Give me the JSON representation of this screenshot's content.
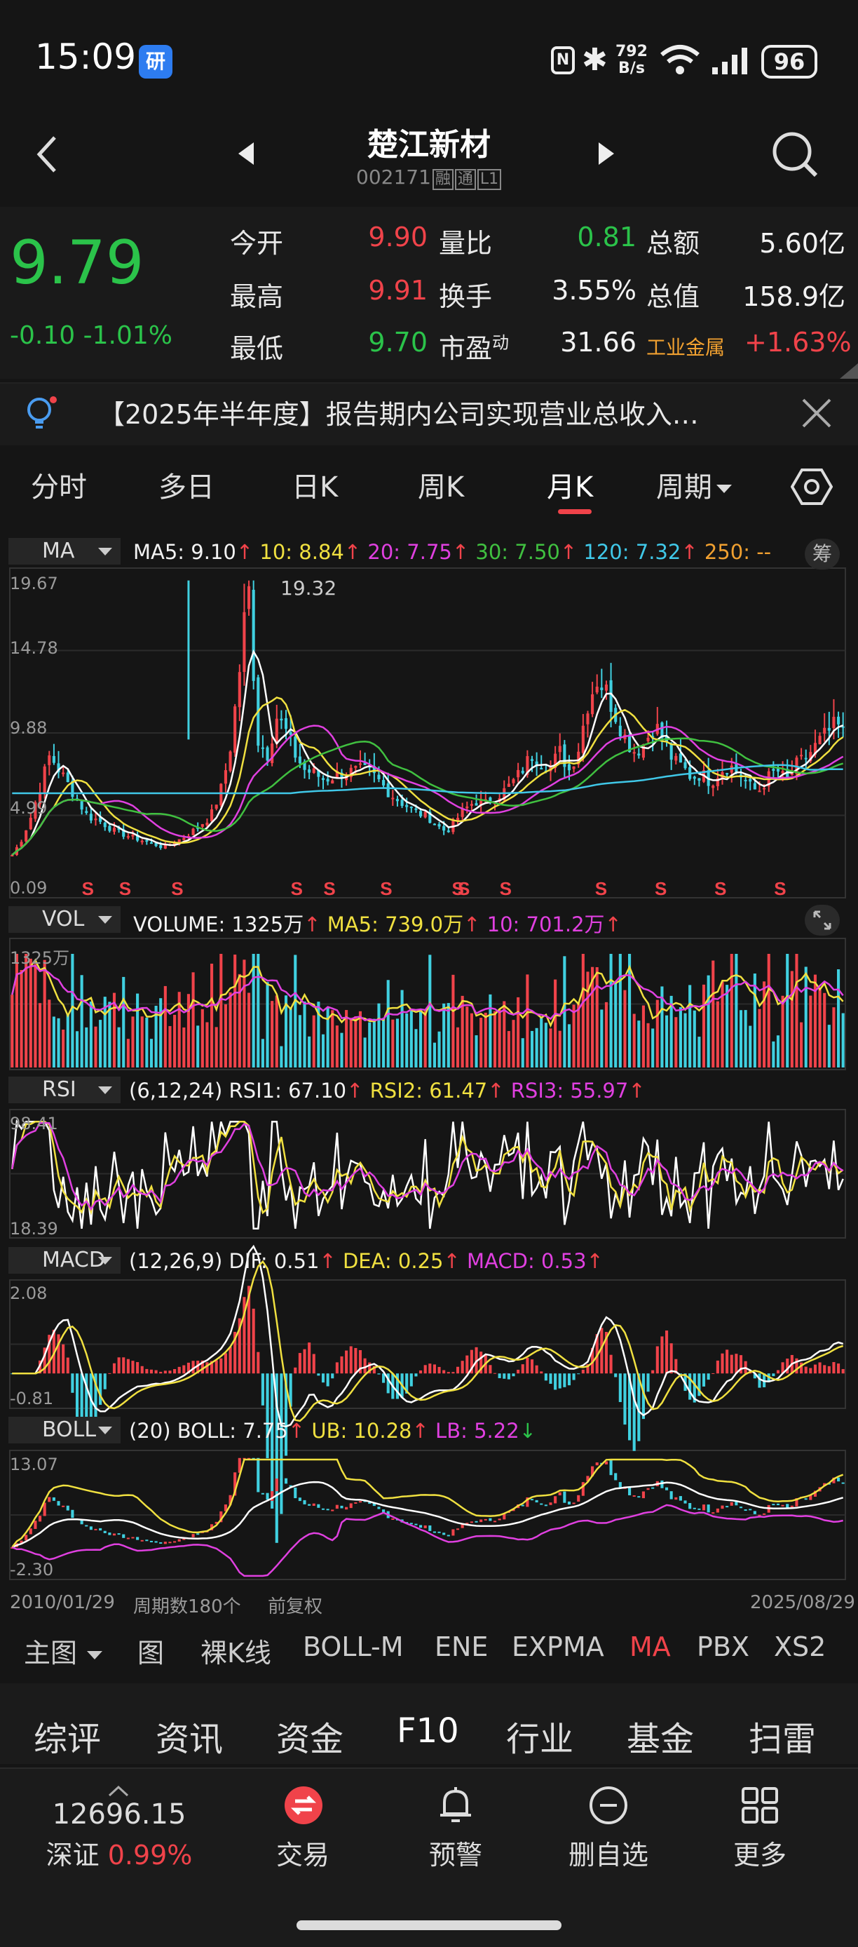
{
  "status": {
    "time": "15:09",
    "app_badge": "研",
    "nfc": "N",
    "bt": "✱",
    "net_value": "792",
    "net_unit": "B/s",
    "battery": "96"
  },
  "header": {
    "name": "楚江新材",
    "code": "002171",
    "tags": [
      "融",
      "通",
      "L1"
    ]
  },
  "quote": {
    "price": "9.79",
    "change": "-0.10",
    "change_pct": "-1.01%",
    "rows": [
      {
        "l1": "今开",
        "v1": "9.90",
        "l2": "量比",
        "v2": "0.81",
        "l3": "总额",
        "v3": "5.60亿"
      },
      {
        "l1": "最高",
        "v1": "9.91",
        "l2": "换手",
        "v2": "3.55%",
        "l3": "总值",
        "v3": "158.9亿"
      },
      {
        "l1": "最低",
        "v1": "9.70",
        "l2": "市盈",
        "l2sup": "动",
        "v2": "31.66"
      }
    ],
    "industry": "工业金属",
    "industry_change": "+1.63%"
  },
  "news": "【2025年半年度】报告期内公司实现营业总收入…",
  "tabs": [
    "分时",
    "多日",
    "日K",
    "周K",
    "月K",
    "周期"
  ],
  "indicators": {
    "ma": {
      "btn": "MA",
      "ma5": "MA5: 9.10",
      "ma10": "10: 8.84",
      "ma20": "20: 7.75",
      "ma30": "30: 7.50",
      "ma120": "120: 7.32",
      "ma250": "250: --",
      "chip": "筹",
      "yticks": [
        "19.67",
        "14.78",
        "9.88",
        "4.99",
        "0.09"
      ],
      "peak": "19.32",
      "signals": [
        "S",
        "S",
        "S",
        "S",
        "S",
        "S",
        "S",
        "S",
        "S",
        "S",
        "S",
        "S",
        "S"
      ]
    },
    "vol": {
      "btn": "VOL",
      "volume": "VOLUME: 1325万",
      "ma5": "MA5: 739.0万",
      "ma10": "10: 701.2万",
      "ytop": "1325万"
    },
    "rsi": {
      "btn": "RSI",
      "params": "(6,12,24)",
      "rsi1": "RSI1: 67.10",
      "rsi2": "RSI2: 61.47",
      "rsi3": "RSI3: 55.97",
      "ytop": "98.41",
      "ybot": "18.39"
    },
    "macd": {
      "btn": "MACD",
      "params": "(12,26,9)",
      "dif": "DIF: 0.51",
      "dea": "DEA: 0.25",
      "macd": "MACD: 0.53",
      "ytop": "2.08",
      "ybot": "-0.81"
    },
    "boll": {
      "btn": "BOLL",
      "params": "(20)",
      "boll": "BOLL: 7.75",
      "ub": "UB: 10.28",
      "lb": "LB: 5.22",
      "ytop": "13.07",
      "ybot": "-2.30"
    }
  },
  "chart_footer": {
    "start": "2010/01/29",
    "periods": "周期数180个",
    "adjust": "前复权",
    "end": "2025/08/29"
  },
  "main_toolbar": [
    "主图",
    "图",
    "裸K线",
    "BOLL-M",
    "ENE",
    "EXPMA",
    "MA",
    "PBX",
    "XS2"
  ],
  "bottom_tabs": [
    "综评",
    "资讯",
    "资金",
    "F10",
    "行业",
    "基金",
    "扫雷"
  ],
  "footer": {
    "index_value": "12696.15",
    "index_name": "深证",
    "index_change": "0.99%",
    "trade": "交易",
    "alert": "预警",
    "remove": "删自选",
    "more": "更多"
  },
  "colors": {
    "up": "#f0434a",
    "down": "#2bc34a",
    "ma5": "#ffffff",
    "ma10": "#f0e040",
    "ma20": "#e040e0",
    "ma30": "#40c040",
    "ma120": "#40c8e8",
    "ma250": "#f0a030"
  },
  "chart_data": {
    "type": "candlestick",
    "price_path": [
      1.5,
      2.5,
      4,
      6,
      8,
      7,
      6,
      5,
      4,
      3.8,
      3.4,
      3.0,
      2.8,
      2.6,
      2.4,
      2.2,
      2.0,
      2.3,
      2.6,
      3.0,
      3.5,
      4.0,
      5.5,
      8,
      13,
      19.3,
      9,
      8,
      10.5,
      9.5,
      8,
      7,
      6.8,
      6.4,
      6.6,
      6.9,
      6.9,
      7,
      6.8,
      6.2,
      5.5,
      5.0,
      4.6,
      4.2,
      4.0,
      3.4,
      3.0,
      3.8,
      4.5,
      5.0,
      4.8,
      5.2,
      5.6,
      6.2,
      7,
      8,
      7.6,
      7.2,
      8.2,
      7,
      8.5,
      11.5,
      13.0,
      12.0,
      10.5,
      9,
      8.2,
      8.8,
      10,
      9,
      7.6,
      7.2,
      6.5,
      6.8,
      6.2,
      7.0,
      7.3,
      6.8,
      6.0,
      5.6,
      6.5,
      7.0,
      6.3,
      7.3,
      7.8,
      8.5,
      9.2,
      9.8,
      9.79
    ]
  }
}
